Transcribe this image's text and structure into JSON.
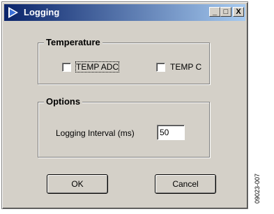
{
  "window": {
    "title": "Logging",
    "minimize_glyph": "_",
    "maximize_glyph": "□",
    "close_glyph": "X"
  },
  "temperature": {
    "legend": "Temperature",
    "temp_adc_label": "TEMP ADC",
    "temp_adc_checked": false,
    "temp_c_label": "TEMP C",
    "temp_c_checked": false
  },
  "options": {
    "legend": "Options",
    "interval_label": "Logging Interval (ms)",
    "interval_value": "50"
  },
  "buttons": {
    "ok_label": "OK",
    "cancel_label": "Cancel"
  },
  "figure_ref": "09023-007"
}
